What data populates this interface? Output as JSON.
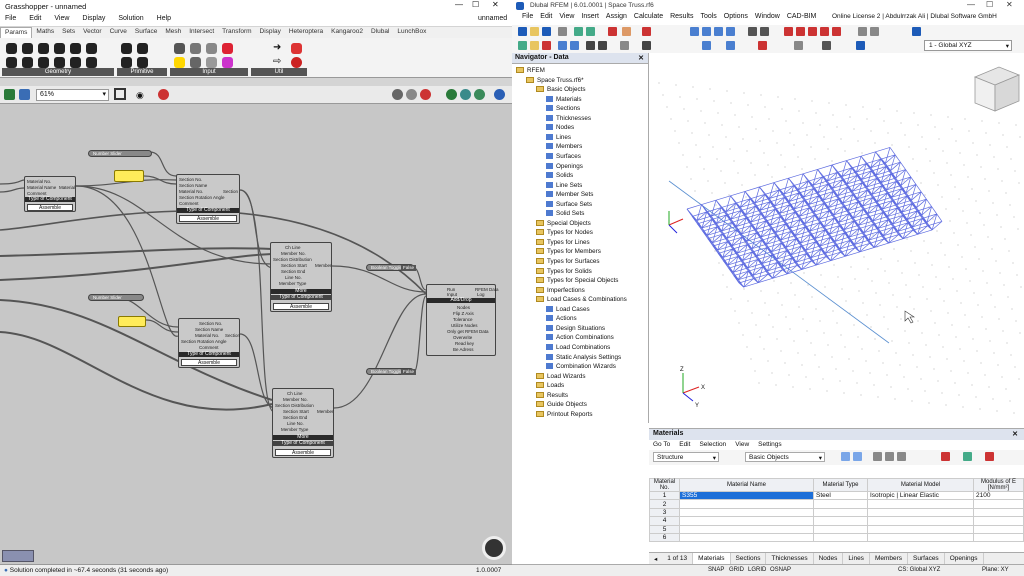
{
  "gh": {
    "title": "Grasshopper - unnamed",
    "doc_name": "unnamed",
    "menu": [
      "File",
      "Edit",
      "View",
      "Display",
      "Solution",
      "Help"
    ],
    "tabs": [
      "Params",
      "Maths",
      "Sets",
      "Vector",
      "Curve",
      "Surface",
      "Mesh",
      "Intersect",
      "Transform",
      "Display",
      "Heteroptera",
      "Kangaroo2",
      "Dlubal",
      "LunchBox"
    ],
    "groups": [
      "Geometry",
      "Primitive",
      "Input",
      "Util"
    ],
    "zoom": "61%",
    "status": "Solution completed in ~67.4 seconds (31 seconds ago)",
    "version": "1.0.0007",
    "nodes": {
      "material": {
        "rows": [
          "Material",
          "Material Name",
          "Comment"
        ],
        "out": "Material",
        "cap": "Type of Component",
        "sel": "Assemble"
      },
      "section": {
        "rows": [
          "Section No.",
          "Section Name",
          "Material No.",
          "Section Rotation Angle",
          "Comment"
        ],
        "out": "Section",
        "cap": "Type of Component",
        "sel": "Assemble"
      },
      "member": {
        "rows": [
          "Ch Line",
          "Member No.",
          "Section Distribution",
          "Section Start",
          "Section End",
          "Line No.",
          "Member Type"
        ],
        "out": "Member",
        "cap": "Type of Component",
        "sel": "Assemble",
        "more": "More"
      },
      "section2": {
        "rows": [
          "Section No.",
          "Section Name",
          "Material No.",
          "Section Rotation Angle",
          "Comment"
        ],
        "out": "Section",
        "cap": "Type of Component",
        "sel": "Assemble"
      },
      "member2": {
        "rows": [
          "Ch Line",
          "Member No.",
          "Section Distribution",
          "Section Start",
          "Section End",
          "Line No.",
          "Member Type"
        ],
        "out": "Member",
        "cap": "Type of Component",
        "sel": "Assemble",
        "more": "More"
      },
      "rfem": {
        "rows": [
          "Run",
          "Input",
          "Nodes",
          "Flip Z Axis",
          "Tolerance",
          "Utilize Nodes",
          "Only get RFEM Data",
          "Overwrite",
          "Read key",
          "Be Adress"
        ],
        "outs": [
          "RFEM Data",
          "Log"
        ],
        "cap": "Add/Drop"
      }
    },
    "pills": [
      "Number Slider",
      "Number Slider",
      "Boolean Toggle",
      "Boolean Toggle"
    ],
    "toggle_vals": [
      "False",
      "False"
    ]
  },
  "rf": {
    "title": "Dlubal RFEM | 6.01.0001 | Space Truss.rf6",
    "menu": [
      "File",
      "Edit",
      "View",
      "Insert",
      "Assign",
      "Calculate",
      "Results",
      "Tools",
      "Options",
      "Window",
      "CAD-BIM"
    ],
    "license": "Online License 2 | Abdulrrzak Ali | Dlubal Software GmbH",
    "view_combo": "1 - Global XYZ",
    "navigator_title": "Navigator - Data",
    "tree": [
      {
        "label": "RFEM",
        "indent": 0,
        "kind": "root"
      },
      {
        "label": "Space Truss.rf6*",
        "indent": 1,
        "kind": "file"
      },
      {
        "label": "Basic Objects",
        "indent": 2,
        "kind": "folder"
      },
      {
        "label": "Materials",
        "indent": 3,
        "kind": "leaf"
      },
      {
        "label": "Sections",
        "indent": 3,
        "kind": "leaf"
      },
      {
        "label": "Thicknesses",
        "indent": 3,
        "kind": "leaf"
      },
      {
        "label": "Nodes",
        "indent": 3,
        "kind": "leaf"
      },
      {
        "label": "Lines",
        "indent": 3,
        "kind": "leaf"
      },
      {
        "label": "Members",
        "indent": 3,
        "kind": "leaf"
      },
      {
        "label": "Surfaces",
        "indent": 3,
        "kind": "leaf"
      },
      {
        "label": "Openings",
        "indent": 3,
        "kind": "leaf"
      },
      {
        "label": "Solids",
        "indent": 3,
        "kind": "leaf"
      },
      {
        "label": "Line Sets",
        "indent": 3,
        "kind": "leaf"
      },
      {
        "label": "Member Sets",
        "indent": 3,
        "kind": "leaf"
      },
      {
        "label": "Surface Sets",
        "indent": 3,
        "kind": "leaf"
      },
      {
        "label": "Solid Sets",
        "indent": 3,
        "kind": "leaf"
      },
      {
        "label": "Special Objects",
        "indent": 2,
        "kind": "folder"
      },
      {
        "label": "Types for Nodes",
        "indent": 2,
        "kind": "folder"
      },
      {
        "label": "Types for Lines",
        "indent": 2,
        "kind": "folder"
      },
      {
        "label": "Types for Members",
        "indent": 2,
        "kind": "folder"
      },
      {
        "label": "Types for Surfaces",
        "indent": 2,
        "kind": "folder"
      },
      {
        "label": "Types for Solids",
        "indent": 2,
        "kind": "folder"
      },
      {
        "label": "Types for Special Objects",
        "indent": 2,
        "kind": "folder"
      },
      {
        "label": "Imperfections",
        "indent": 2,
        "kind": "folder"
      },
      {
        "label": "Load Cases & Combinations",
        "indent": 2,
        "kind": "folder"
      },
      {
        "label": "Load Cases",
        "indent": 3,
        "kind": "leaf"
      },
      {
        "label": "Actions",
        "indent": 3,
        "kind": "leaf"
      },
      {
        "label": "Design Situations",
        "indent": 3,
        "kind": "leaf"
      },
      {
        "label": "Action Combinations",
        "indent": 3,
        "kind": "leaf"
      },
      {
        "label": "Load Combinations",
        "indent": 3,
        "kind": "leaf"
      },
      {
        "label": "Static Analysis Settings",
        "indent": 3,
        "kind": "leaf"
      },
      {
        "label": "Combination Wizards",
        "indent": 3,
        "kind": "leaf"
      },
      {
        "label": "Load Wizards",
        "indent": 2,
        "kind": "folder"
      },
      {
        "label": "Loads",
        "indent": 2,
        "kind": "folder"
      },
      {
        "label": "Results",
        "indent": 2,
        "kind": "folder"
      },
      {
        "label": "Guide Objects",
        "indent": 2,
        "kind": "folder"
      },
      {
        "label": "Printout Reports",
        "indent": 2,
        "kind": "folder"
      }
    ],
    "materials": {
      "title": "Materials",
      "menu": [
        "Go To",
        "Edit",
        "Selection",
        "View",
        "Settings"
      ],
      "dd1": "Structure",
      "dd2": "Basic Objects",
      "headers": [
        "Material No.",
        "Material Name",
        "Material Type",
        "Material Model",
        "Modulus of E [N/mm²]"
      ],
      "rows": [
        {
          "no": "1",
          "name": "S355",
          "type": "Steel",
          "model": "Isotropic | Linear Elastic",
          "e": "2100"
        },
        {
          "no": "2",
          "name": "",
          "type": "",
          "model": "",
          "e": ""
        },
        {
          "no": "3",
          "name": "",
          "type": "",
          "model": "",
          "e": ""
        },
        {
          "no": "4",
          "name": "",
          "type": "",
          "model": "",
          "e": ""
        },
        {
          "no": "5",
          "name": "",
          "type": "",
          "model": "",
          "e": ""
        },
        {
          "no": "6",
          "name": "",
          "type": "",
          "model": "",
          "e": ""
        }
      ],
      "pager": "1 of 13",
      "tabs": [
        "Materials",
        "Sections",
        "Thicknesses",
        "Nodes",
        "Lines",
        "Members",
        "Surfaces",
        "Openings"
      ]
    },
    "status_items": [
      "SNAP",
      "GRID",
      "LGRID",
      "OSNAP"
    ],
    "cs": "CS: Global XYZ",
    "plane": "Plane: XY"
  }
}
